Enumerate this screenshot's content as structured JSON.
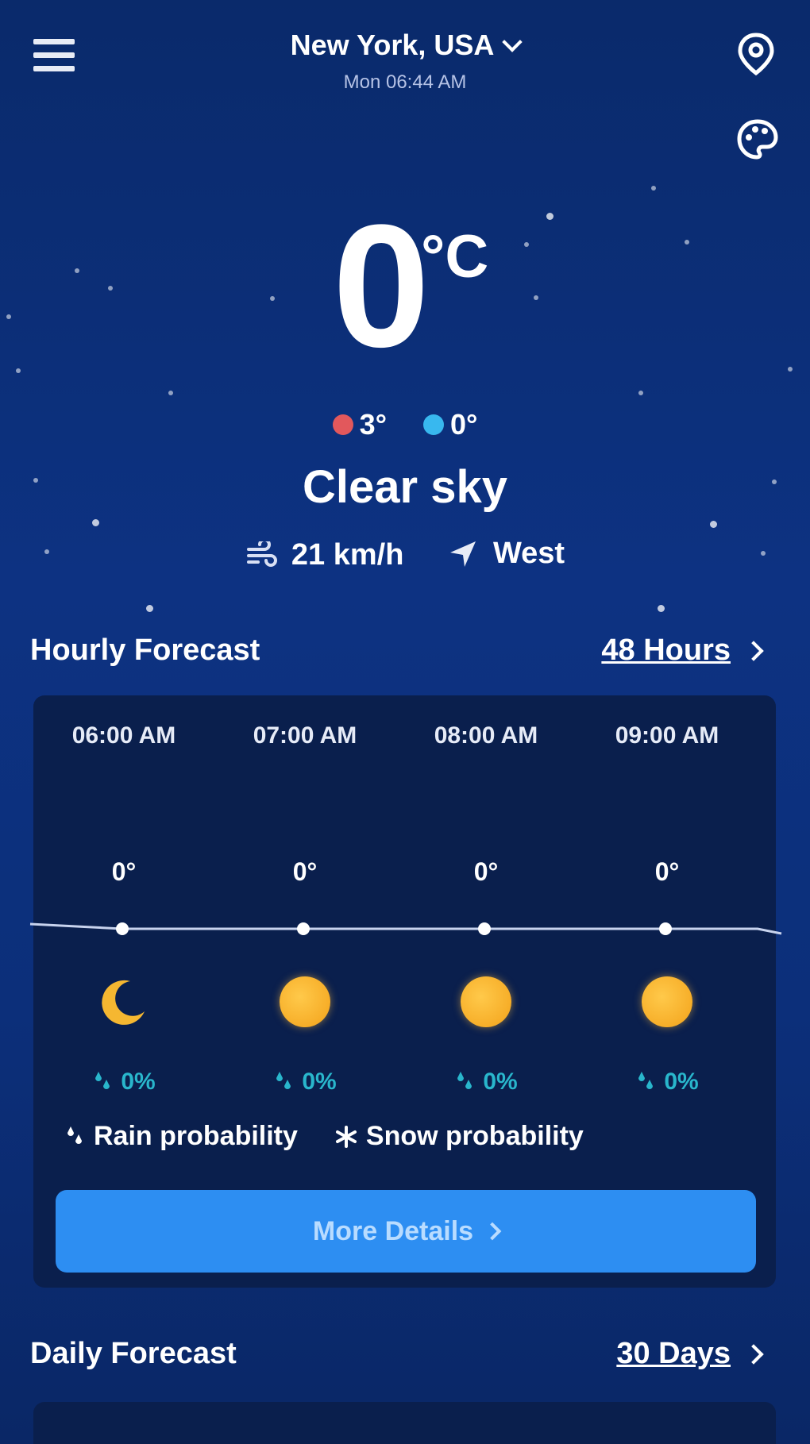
{
  "header": {
    "city": "New York, USA",
    "time": "Mon 06:44 AM"
  },
  "current": {
    "temperature": "0",
    "unit": "°C",
    "high": "3°",
    "low": "0°",
    "condition": "Clear sky",
    "wind_speed": "21 km/h",
    "wind_direction": "West"
  },
  "hourly": {
    "title": "Hourly Forecast",
    "link": "48 Hours",
    "items": [
      {
        "time": "06:00 AM",
        "temp": "0°",
        "icon": "moon-icon",
        "precip": "0%"
      },
      {
        "time": "07:00 AM",
        "temp": "0°",
        "icon": "sun-icon",
        "precip": "0%"
      },
      {
        "time": "08:00 AM",
        "temp": "0°",
        "icon": "sun-icon",
        "precip": "0%"
      },
      {
        "time": "09:00 AM",
        "temp": "0°",
        "icon": "sun-icon",
        "precip": "0%"
      }
    ],
    "legend_rain": "Rain probability",
    "legend_snow": "Snow probability",
    "button": "More Details"
  },
  "daily": {
    "title": "Daily Forecast",
    "link": "30 Days"
  },
  "colors": {
    "background": "#0c2f7a",
    "card": "#0a1f4d",
    "accent_button": "#2d8ef2",
    "precip_text": "#29b6cc",
    "high_dot": "#e2585c",
    "low_dot": "#38b8ef",
    "sun": "#f3a21a"
  }
}
